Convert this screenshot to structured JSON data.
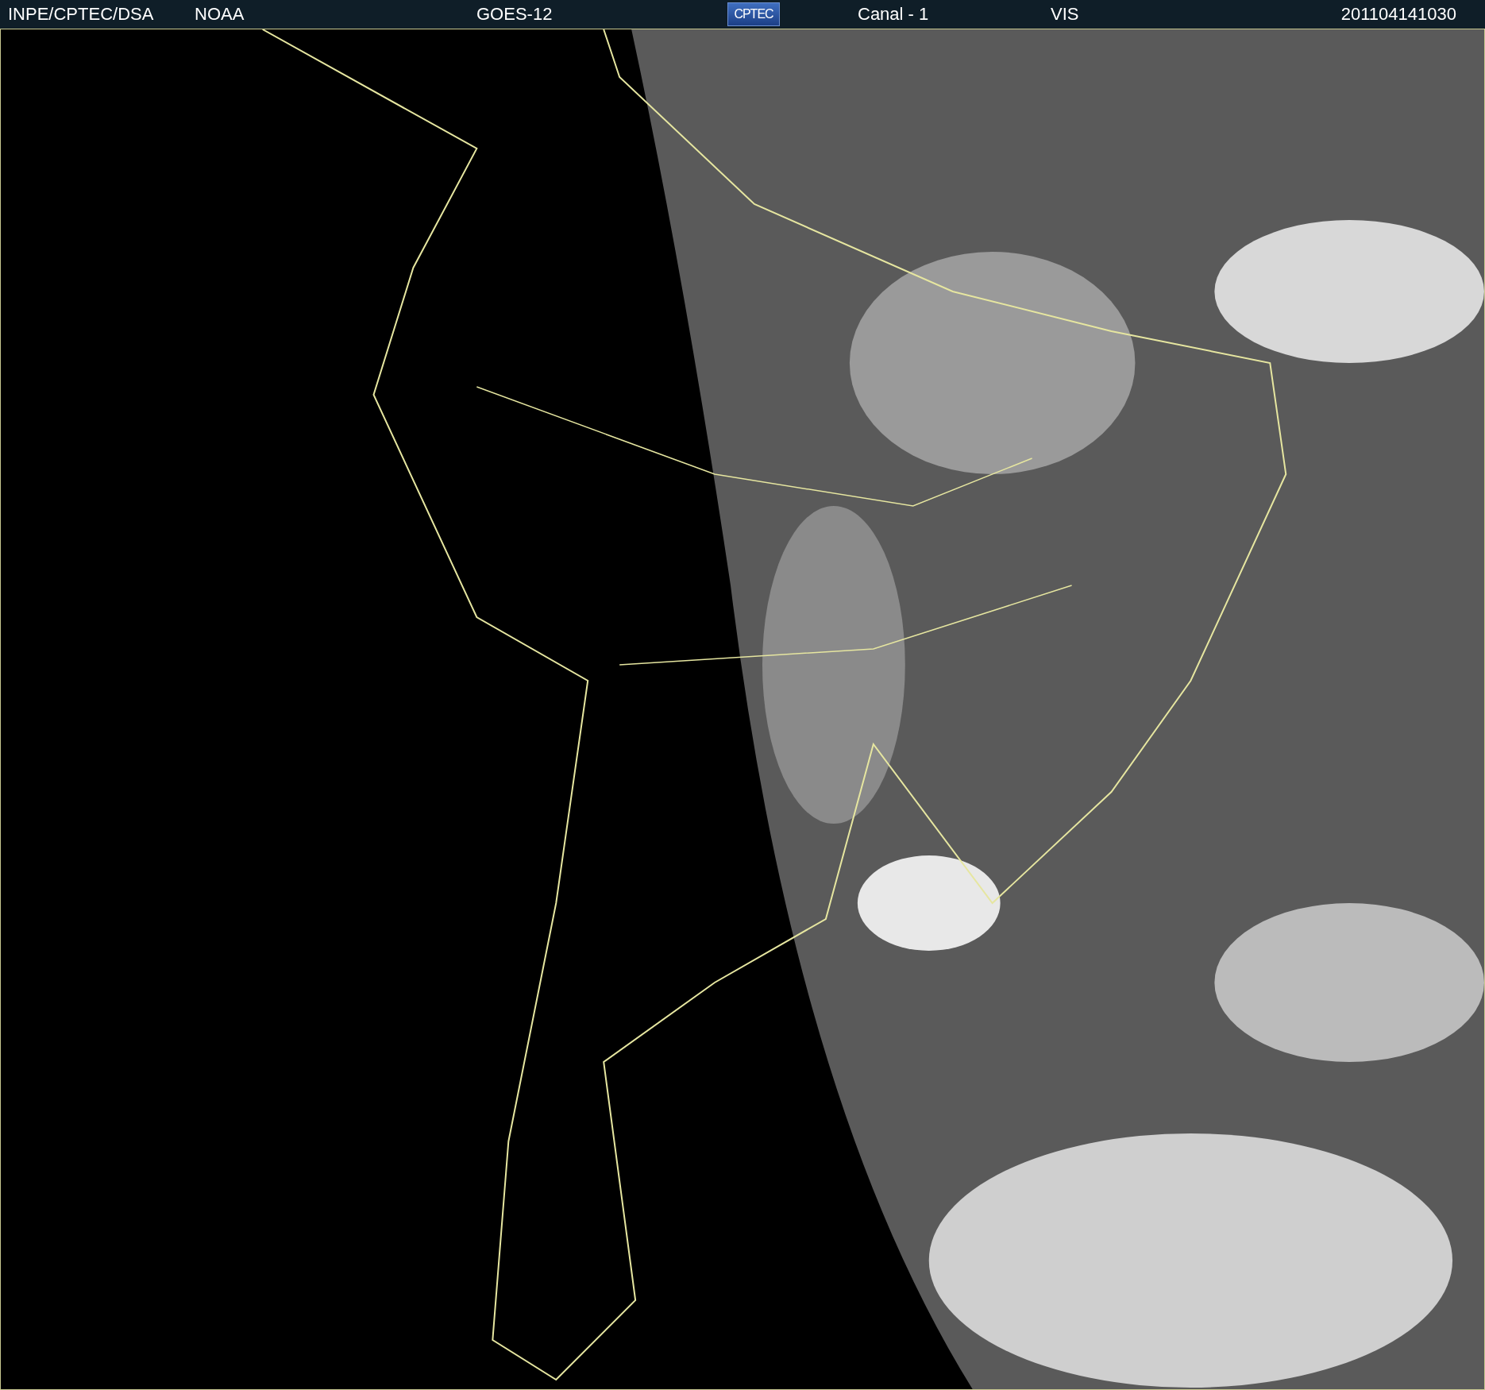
{
  "header": {
    "source": "INPE/CPTEC/DSA",
    "agency": "NOAA",
    "satellite": "GOES-12",
    "logo": "CPTEC",
    "channel": "Canal - 1",
    "band": "VIS",
    "timestamp": "201104141030"
  }
}
